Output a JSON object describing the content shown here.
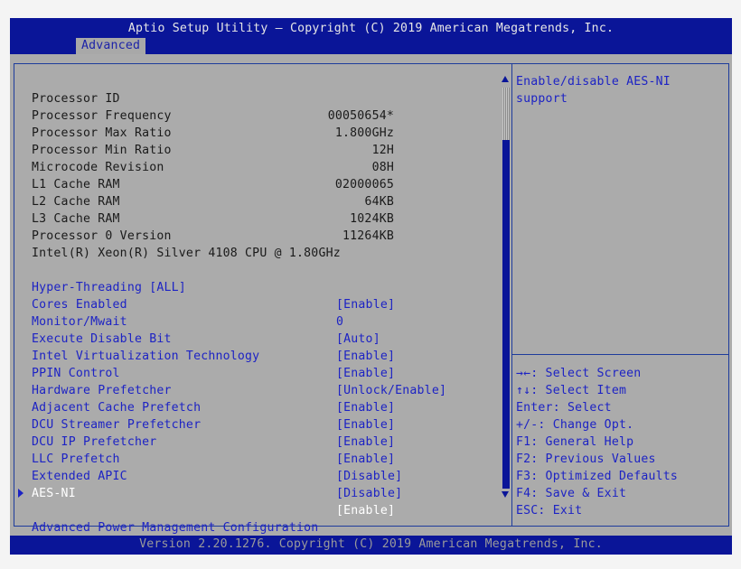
{
  "header": {
    "title": "Aptio Setup Utility – Copyright (C) 2019 American Megatrends, Inc.",
    "tab": "Advanced"
  },
  "info_rows": [
    {
      "label": "Processor ID",
      "value": "00050654*"
    },
    {
      "label": "Processor Frequency",
      "value": "1.800GHz"
    },
    {
      "label": "Processor Max Ratio",
      "value": "12H"
    },
    {
      "label": "Processor Min Ratio",
      "value": "08H"
    },
    {
      "label": "Microcode Revision",
      "value": "02000065"
    },
    {
      "label": "L1 Cache RAM",
      "value": "64KB"
    },
    {
      "label": "L2 Cache RAM",
      "value": "1024KB"
    },
    {
      "label": "L3 Cache RAM",
      "value": "11264KB"
    }
  ],
  "processor_version": {
    "label": "Processor 0 Version",
    "value": "Intel(R) Xeon(R) Silver 4108 CPU @ 1.80GHz"
  },
  "settings": [
    {
      "label": "Hyper-Threading [ALL]",
      "value": "[Enable]"
    },
    {
      "label": "Cores Enabled",
      "value": "0"
    },
    {
      "label": "Monitor/Mwait",
      "value": "[Auto]"
    },
    {
      "label": "Execute Disable Bit",
      "value": "[Enable]"
    },
    {
      "label": "Intel Virtualization Technology",
      "value": "[Enable]"
    },
    {
      "label": "PPIN Control",
      "value": "[Unlock/Enable]"
    },
    {
      "label": "Hardware Prefetcher",
      "value": "[Enable]"
    },
    {
      "label": "Adjacent Cache Prefetch",
      "value": "[Enable]"
    },
    {
      "label": "DCU Streamer Prefetcher",
      "value": "[Enable]"
    },
    {
      "label": "DCU IP Prefetcher",
      "value": "[Enable]"
    },
    {
      "label": "LLC Prefetch",
      "value": "[Disable]"
    },
    {
      "label": "Extended APIC",
      "value": "[Disable]"
    },
    {
      "label": "AES-NI",
      "value": "[Enable]"
    }
  ],
  "submenu": {
    "label": "Advanced Power Management Configuration"
  },
  "help": {
    "line1": "Enable/disable AES-NI",
    "line2": "support"
  },
  "keys": [
    "→←: Select Screen",
    "↑↓: Select Item",
    "Enter: Select",
    "+/-: Change Opt.",
    "F1: General Help",
    "F2: Previous Values",
    "F3: Optimized Defaults",
    "F4: Save & Exit",
    "ESC: Exit"
  ],
  "footer": "Version 2.20.1276. Copyright (C) 2019 American Megatrends, Inc.",
  "colors": {
    "header_bg": "#0a1598",
    "panel_bg": "#ababab",
    "setting_text": "#1d23c4",
    "selected_text": "#ffffff"
  }
}
